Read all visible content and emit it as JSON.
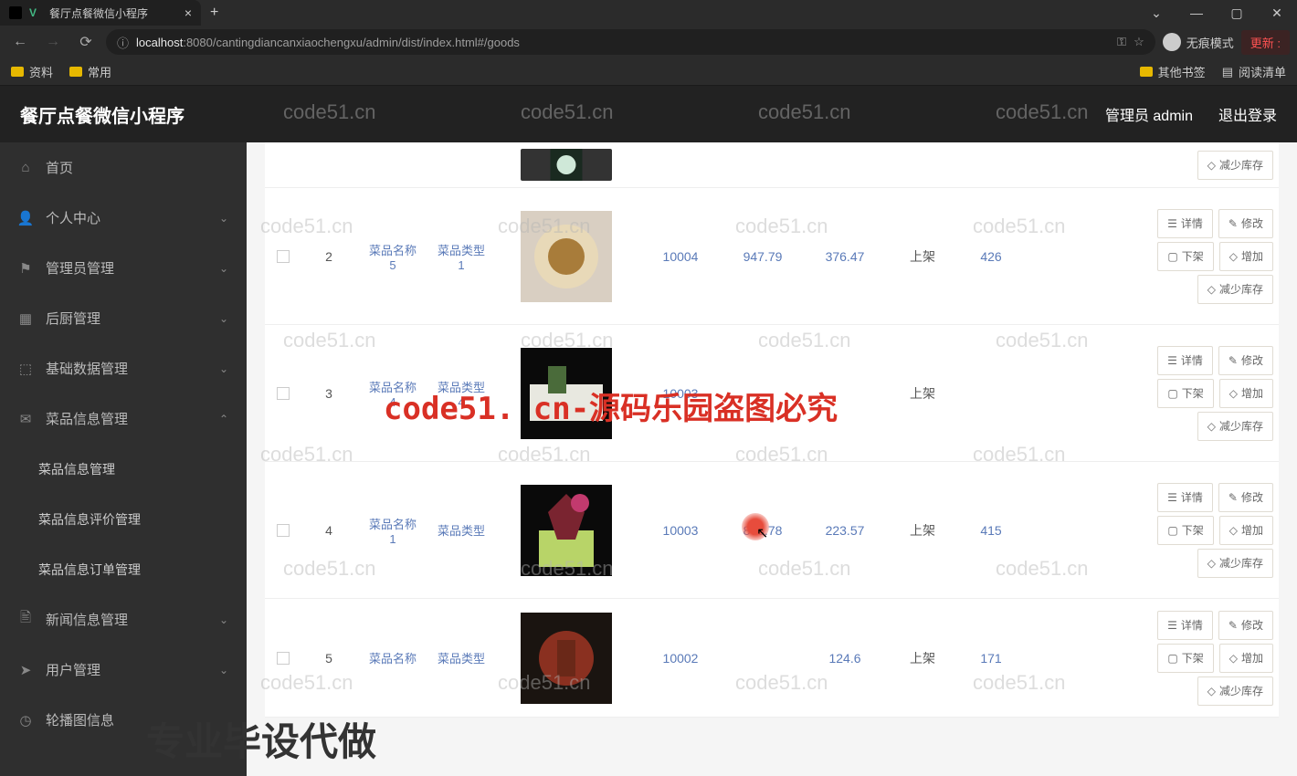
{
  "browser": {
    "tab_title": "餐厅点餐微信小程序",
    "url_prefix": "localhost",
    "url_port": ":8080",
    "url_path": "/cantingdiancanxiaochengxu/admin/dist/index.html#/goods",
    "incognito_label": "无痕模式",
    "update_label": "更新",
    "bookmarks": {
      "b1": "资料",
      "b2": "常用",
      "other": "其他书签",
      "reading": "阅读清单"
    }
  },
  "app": {
    "title": "餐厅点餐微信小程序",
    "header_user": "管理员 admin",
    "header_logout": "退出登录"
  },
  "sidebar": {
    "home": "首页",
    "personal": "个人中心",
    "admin": "管理员管理",
    "kitchen": "后厨管理",
    "basic": "基础数据管理",
    "dish": "菜品信息管理",
    "dish_info": "菜品信息管理",
    "dish_review": "菜品信息评价管理",
    "dish_order": "菜品信息订单管理",
    "news": "新闻信息管理",
    "user": "用户管理",
    "carousel": "轮播图信息"
  },
  "table": {
    "col_name": "菜品名称",
    "col_type": "菜品类型",
    "rows": [
      {
        "idx": "",
        "name_sub": "",
        "type_sub": "",
        "stock": "",
        "oprice": "",
        "price": "",
        "status": "",
        "clicks": ""
      },
      {
        "idx": "2",
        "name_sub": "5",
        "type_sub": "1",
        "stock": "10004",
        "oprice": "947.79",
        "price": "376.47",
        "status": "上架",
        "clicks": "426"
      },
      {
        "idx": "3",
        "name_sub": "4",
        "type_sub": "4",
        "stock": "10003",
        "oprice": "",
        "price": "",
        "status": "上架",
        "clicks": ""
      },
      {
        "idx": "4",
        "name_sub": "1",
        "type_sub": "",
        "stock": "10003",
        "oprice": "876.78",
        "price": "223.57",
        "status": "上架",
        "clicks": "415"
      },
      {
        "idx": "5",
        "name_sub": "",
        "type_sub": "",
        "stock": "10002",
        "oprice": "",
        "price": "124.6",
        "status": "上架",
        "clicks": "171"
      }
    ],
    "actions": {
      "detail": "详情",
      "edit": "修改",
      "off": "下架",
      "add": "增加",
      "reduce": "减少库存"
    }
  },
  "watermarks": {
    "small": "code51.cn",
    "big": "code51. cn-源码乐园盗图必究",
    "bottom": "专业毕设代做"
  }
}
